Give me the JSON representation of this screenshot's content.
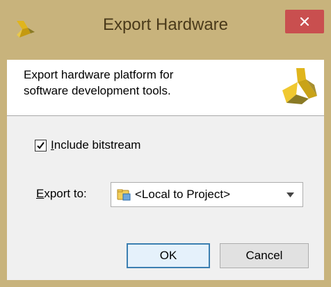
{
  "window": {
    "title": "Export Hardware",
    "icons": {
      "app": "xilinx-logo-icon",
      "close": "close-icon"
    },
    "colors": {
      "titlebar": "#c8b37c",
      "close_button": "#c94f4f",
      "logo_yellow": "#e0b51c",
      "logo_olive": "#8a7a25"
    }
  },
  "header": {
    "description": "Export hardware platform for\nsoftware development tools.",
    "logo_icon": "xilinx-logo-icon"
  },
  "options": {
    "include_bitstream": {
      "checked": true,
      "label_underlined": "I",
      "label_rest": "nclude bitstream"
    },
    "export_to": {
      "label_underlined": "E",
      "label_rest": "xport to:",
      "selected_value": "<Local to Project>",
      "folder_icon": "folder-icon",
      "arrow_icon": "chevron-down-icon"
    }
  },
  "buttons": {
    "ok": "OK",
    "cancel": "Cancel"
  }
}
